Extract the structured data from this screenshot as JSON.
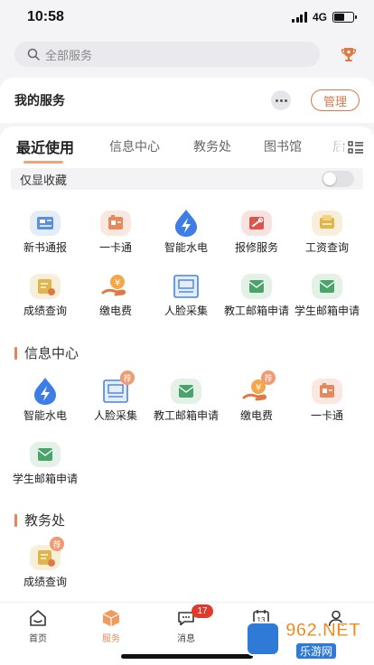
{
  "status_bar": {
    "time": "10:58",
    "network": "4G"
  },
  "search": {
    "placeholder": "全部服务"
  },
  "my_service": {
    "title": "我的服务",
    "manage_label": "管理"
  },
  "tabs": [
    {
      "label": "最近使用",
      "active": true
    },
    {
      "label": "信息中心",
      "active": false
    },
    {
      "label": "教务处",
      "active": false
    },
    {
      "label": "图书馆",
      "active": false
    },
    {
      "label": "后",
      "active": false
    }
  ],
  "favorites": {
    "label": "仅显收藏",
    "enabled": false
  },
  "recent": [
    {
      "label": "新书通报",
      "icon": "newspaper-icon"
    },
    {
      "label": "一卡通",
      "icon": "campus-card-icon"
    },
    {
      "label": "智能水电",
      "icon": "utility-bolt-icon"
    },
    {
      "label": "报修服务",
      "icon": "repair-icon"
    },
    {
      "label": "工资查询",
      "icon": "salary-icon"
    },
    {
      "label": "成绩查询",
      "icon": "grade-icon"
    },
    {
      "label": "缴电费",
      "icon": "payment-icon"
    },
    {
      "label": "人脸采集",
      "icon": "face-capture-icon"
    },
    {
      "label": "教工邮箱申请",
      "icon": "mail-icon"
    },
    {
      "label": "学生邮箱申请",
      "icon": "mail-icon"
    }
  ],
  "sections": [
    {
      "title": "信息中心",
      "items": [
        {
          "label": "智能水电",
          "icon": "utility-bolt-icon",
          "badge": ""
        },
        {
          "label": "人脸采集",
          "icon": "face-capture-icon",
          "badge": "荐"
        },
        {
          "label": "教工邮箱申请",
          "icon": "mail-icon",
          "badge": ""
        },
        {
          "label": "缴电费",
          "icon": "payment-icon",
          "badge": "荐"
        },
        {
          "label": "一卡通",
          "icon": "campus-card-icon",
          "badge": ""
        },
        {
          "label": "学生邮箱申请",
          "icon": "mail-icon",
          "badge": ""
        }
      ]
    },
    {
      "title": "教务处",
      "items": [
        {
          "label": "成绩查询",
          "icon": "grade-icon",
          "badge": "荐"
        }
      ]
    }
  ],
  "bottom_nav": [
    {
      "label": "首页",
      "icon": "home-icon",
      "active": false
    },
    {
      "label": "服务",
      "icon": "service-box-icon",
      "active": true
    },
    {
      "label": "消息",
      "icon": "message-icon",
      "active": false,
      "badge": "17"
    },
    {
      "label": "",
      "icon": "calendar-icon",
      "active": false,
      "calendar_day": "13"
    },
    {
      "label": "",
      "icon": "person-icon",
      "active": false
    }
  ],
  "watermark": {
    "main": "962.NET",
    "sub": "乐游网"
  },
  "colors": {
    "accent": "#e88d5f",
    "badge_red": "#e03a2e",
    "section_bar": "#e6845a"
  }
}
